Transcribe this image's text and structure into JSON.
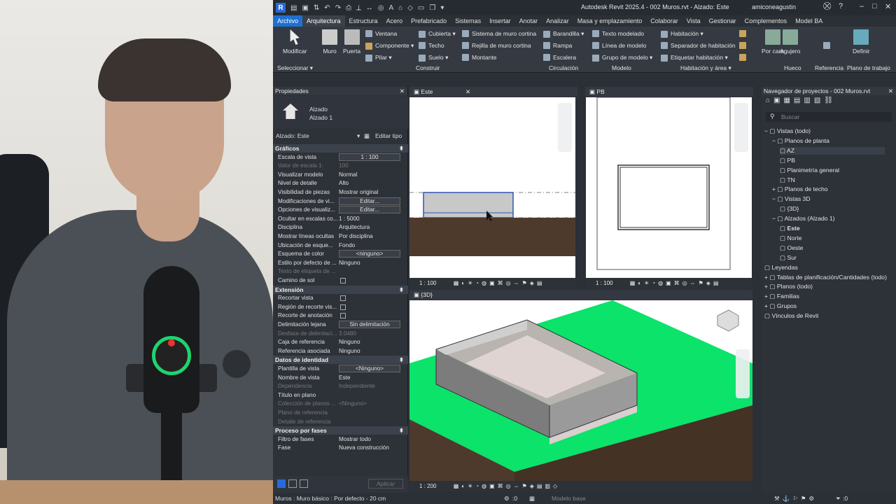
{
  "titlebar": {
    "title": "Autodesk Revit 2025.4 - 002 Muros.rvt - Alzado: Este",
    "user": "amiconeagustin"
  },
  "menu": {
    "tabs": [
      "Archivo",
      "Arquitectura",
      "Estructura",
      "Acero",
      "Prefabricado",
      "Sistemas",
      "Insertar",
      "Anotar",
      "Analizar",
      "Masa y emplazamiento",
      "Colaborar",
      "Vista",
      "Gestionar",
      "Complementos",
      "Model BA"
    ],
    "active": "Arquitectura"
  },
  "ribbon": {
    "modify": "Modificar",
    "select": "Seleccionar ▾",
    "wall": "Muro",
    "door": "Puerta",
    "window": "Ventana",
    "component": "Componente ▾",
    "column": "Pilar ▾",
    "roof": "Cubierta ▾",
    "ceiling": "Techo",
    "floor": "Suelo ▾",
    "curtain_system": "Sistema de muro cortina",
    "curtain_grid": "Rejilla de muro cortina",
    "mullion": "Montante",
    "build_label": "Construir",
    "railing": "Barandilla ▾",
    "ramp": "Rampa",
    "stair": "Escalera",
    "circulation_label": "Circulación",
    "model_text": "Texto modelado",
    "model_line": "Línea de modelo",
    "model_group": "Grupo de modelo ▾",
    "model_label": "Modelo",
    "room": "Habitación ▾",
    "room_sep": "Separador de habitación",
    "tag_room": "Etiquetar habitación ▾",
    "room_label": "Habitación y área ▾",
    "by_face": "Por cara",
    "shaft": "Agujero",
    "opening_label": "Hueco",
    "reference_label": "Referencia",
    "define": "Definir",
    "workplane_label": "Plano de trabajo"
  },
  "properties": {
    "title": "Propiedades",
    "type_family": "Alzado",
    "type_name": "Alzado 1",
    "selector": "Alzado: Este",
    "edit_type": "Editar tipo",
    "sections": [
      {
        "name": "Gráficos",
        "rows": [
          {
            "k": "Escala de vista",
            "v": "1 : 100",
            "box": true
          },
          {
            "k": "Valor de escala    1:",
            "v": "100",
            "dim": true
          },
          {
            "k": "Visualizar modelo",
            "v": "Normal"
          },
          {
            "k": "Nivel de detalle",
            "v": "Alto"
          },
          {
            "k": "Visibilidad de piezas",
            "v": "Mostrar original"
          },
          {
            "k": "Modificaciones de vi...",
            "v": "Editar...",
            "box": true
          },
          {
            "k": "Opciones de visualiz...",
            "v": "Editar...",
            "box": true
          },
          {
            "k": "Ocultar en escalas co...",
            "v": "1 : 5000"
          },
          {
            "k": "Disciplina",
            "v": "Arquitectura"
          },
          {
            "k": "Mostrar líneas ocultas",
            "v": "Por disciplina"
          },
          {
            "k": "Ubicación de esque...",
            "v": "Fondo"
          },
          {
            "k": "Esquema de color",
            "v": "<ninguno>",
            "box": true
          },
          {
            "k": "Estilo por defecto de ...",
            "v": "Ninguno"
          },
          {
            "k": "Texto de etiqueta de ...",
            "v": "",
            "dim": true
          },
          {
            "k": "Camino de sol",
            "v": "",
            "chk": true
          }
        ]
      },
      {
        "name": "Extensión",
        "rows": [
          {
            "k": "Recortar vista",
            "v": "",
            "chk": true
          },
          {
            "k": "Región de recorte vis...",
            "v": "",
            "chk": true
          },
          {
            "k": "Recorte de anotación",
            "v": "",
            "chk": true
          },
          {
            "k": "Delimitación lejana",
            "v": "Sin delimitación",
            "box": true
          },
          {
            "k": "Desfase de delimitaci...",
            "v": "3.0480",
            "dim": true
          },
          {
            "k": "Caja de referencia",
            "v": "Ninguno"
          },
          {
            "k": "Referencia asociada",
            "v": "Ninguno"
          }
        ]
      },
      {
        "name": "Datos de identidad",
        "rows": [
          {
            "k": "Plantilla de vista",
            "v": "<Ninguno>",
            "box": true
          },
          {
            "k": "Nombre de vista",
            "v": "Este"
          },
          {
            "k": "Dependencia",
            "v": "Independiente",
            "dim": true
          },
          {
            "k": "Título en plano",
            "v": ""
          },
          {
            "k": "Colección de planos ...",
            "v": "<Ninguno>",
            "dim": true
          },
          {
            "k": "Plano de referencia",
            "v": "",
            "dim": true
          },
          {
            "k": "Detalle de referencia",
            "v": "",
            "dim": true
          }
        ]
      },
      {
        "name": "Proceso por fases",
        "rows": [
          {
            "k": "Filtro de fases",
            "v": "Mostrar todo"
          },
          {
            "k": "Fase",
            "v": "Nueva construcción"
          }
        ]
      }
    ],
    "apply": "Aplicar"
  },
  "views": {
    "east": {
      "tab": "Este",
      "scale": "1 : 100"
    },
    "pb": {
      "tab": "PB",
      "scale": "1 : 100"
    },
    "threed": {
      "tab": "{3D}",
      "scale": "1 : 200"
    }
  },
  "browser": {
    "title": "Navegador de proyectos - 002 Muros.rvt",
    "search": "Buscar",
    "items": [
      {
        "t": "Vistas (todo)",
        "d": 1,
        "e": "−"
      },
      {
        "t": "Planos de planta",
        "d": 2,
        "e": "−"
      },
      {
        "t": "AZ",
        "d": 3,
        "sel": true
      },
      {
        "t": "PB",
        "d": 3
      },
      {
        "t": "Planimetría general",
        "d": 3
      },
      {
        "t": "TN",
        "d": 3
      },
      {
        "t": "Planos de techo",
        "d": 2,
        "e": "+"
      },
      {
        "t": "Vistas 3D",
        "d": 2,
        "e": "−"
      },
      {
        "t": "{3D}",
        "d": 3
      },
      {
        "t": "Alzados (Alzado 1)",
        "d": 2,
        "e": "−"
      },
      {
        "t": "Este",
        "d": 3,
        "bold": true
      },
      {
        "t": "Norte",
        "d": 3
      },
      {
        "t": "Oeste",
        "d": 3
      },
      {
        "t": "Sur",
        "d": 3
      },
      {
        "t": "Leyendas",
        "d": 1
      },
      {
        "t": "Tablas de planificación/Cantidades (todo)",
        "d": 1,
        "e": "+"
      },
      {
        "t": "Planos (todo)",
        "d": 1,
        "e": "+"
      },
      {
        "t": "Familias",
        "d": 1,
        "e": "+"
      },
      {
        "t": "Grupos",
        "d": 1,
        "e": "+"
      },
      {
        "t": "Vínculos de Revit",
        "d": 1
      }
    ]
  },
  "status": {
    "text": "Muros : Muro básico : Por defecto - 20 cm",
    "zero": ":0",
    "model": "Modelo base",
    "filter": ":0"
  },
  "colors": {
    "accent": "#1f6fcf",
    "grass": "#0be36a",
    "ground": "#4e3a2c"
  }
}
